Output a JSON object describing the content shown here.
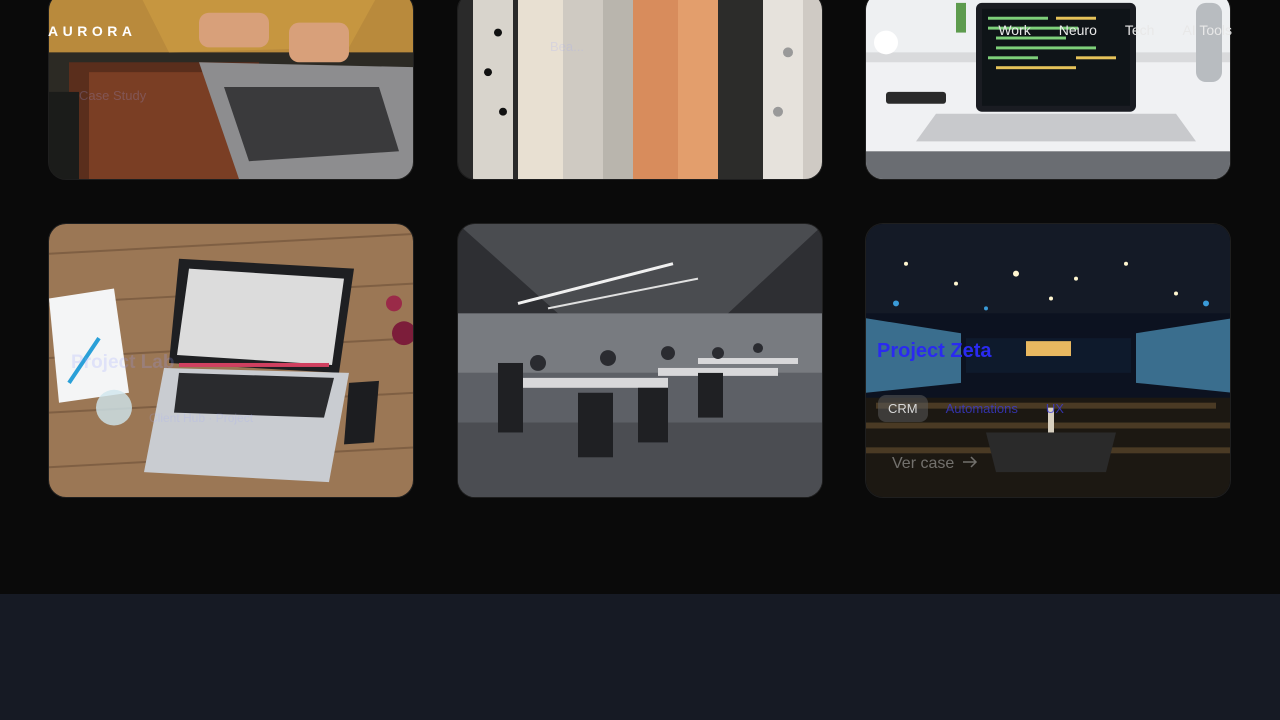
{
  "brand": {
    "logo": "AURORA"
  },
  "nav": {
    "items": [
      {
        "label": "Work"
      },
      {
        "label": "Neuro"
      },
      {
        "label": "Tech"
      },
      {
        "label": "AI Tools"
      }
    ]
  },
  "cards": {
    "row1": [
      {
        "ghost": "Case Study"
      },
      {
        "ghost": "Bea..."
      },
      {
        "ghost": ""
      }
    ],
    "row2": [
      {
        "ghost_title": "Project Lab",
        "ghost_sub": "Client Hub · Project"
      },
      {
        "ghost_title": "",
        "ghost_sub": ""
      },
      {
        "title": "Project Zeta",
        "tags": [
          "CRM",
          "Automations",
          "UX"
        ],
        "cta": "Ver case",
        "cta_icon": "arrow-right-icon"
      }
    ]
  },
  "colors": {
    "background": "#0a0a0a",
    "bottom_band": "#161a24",
    "accent_title": "#2a2af0"
  }
}
